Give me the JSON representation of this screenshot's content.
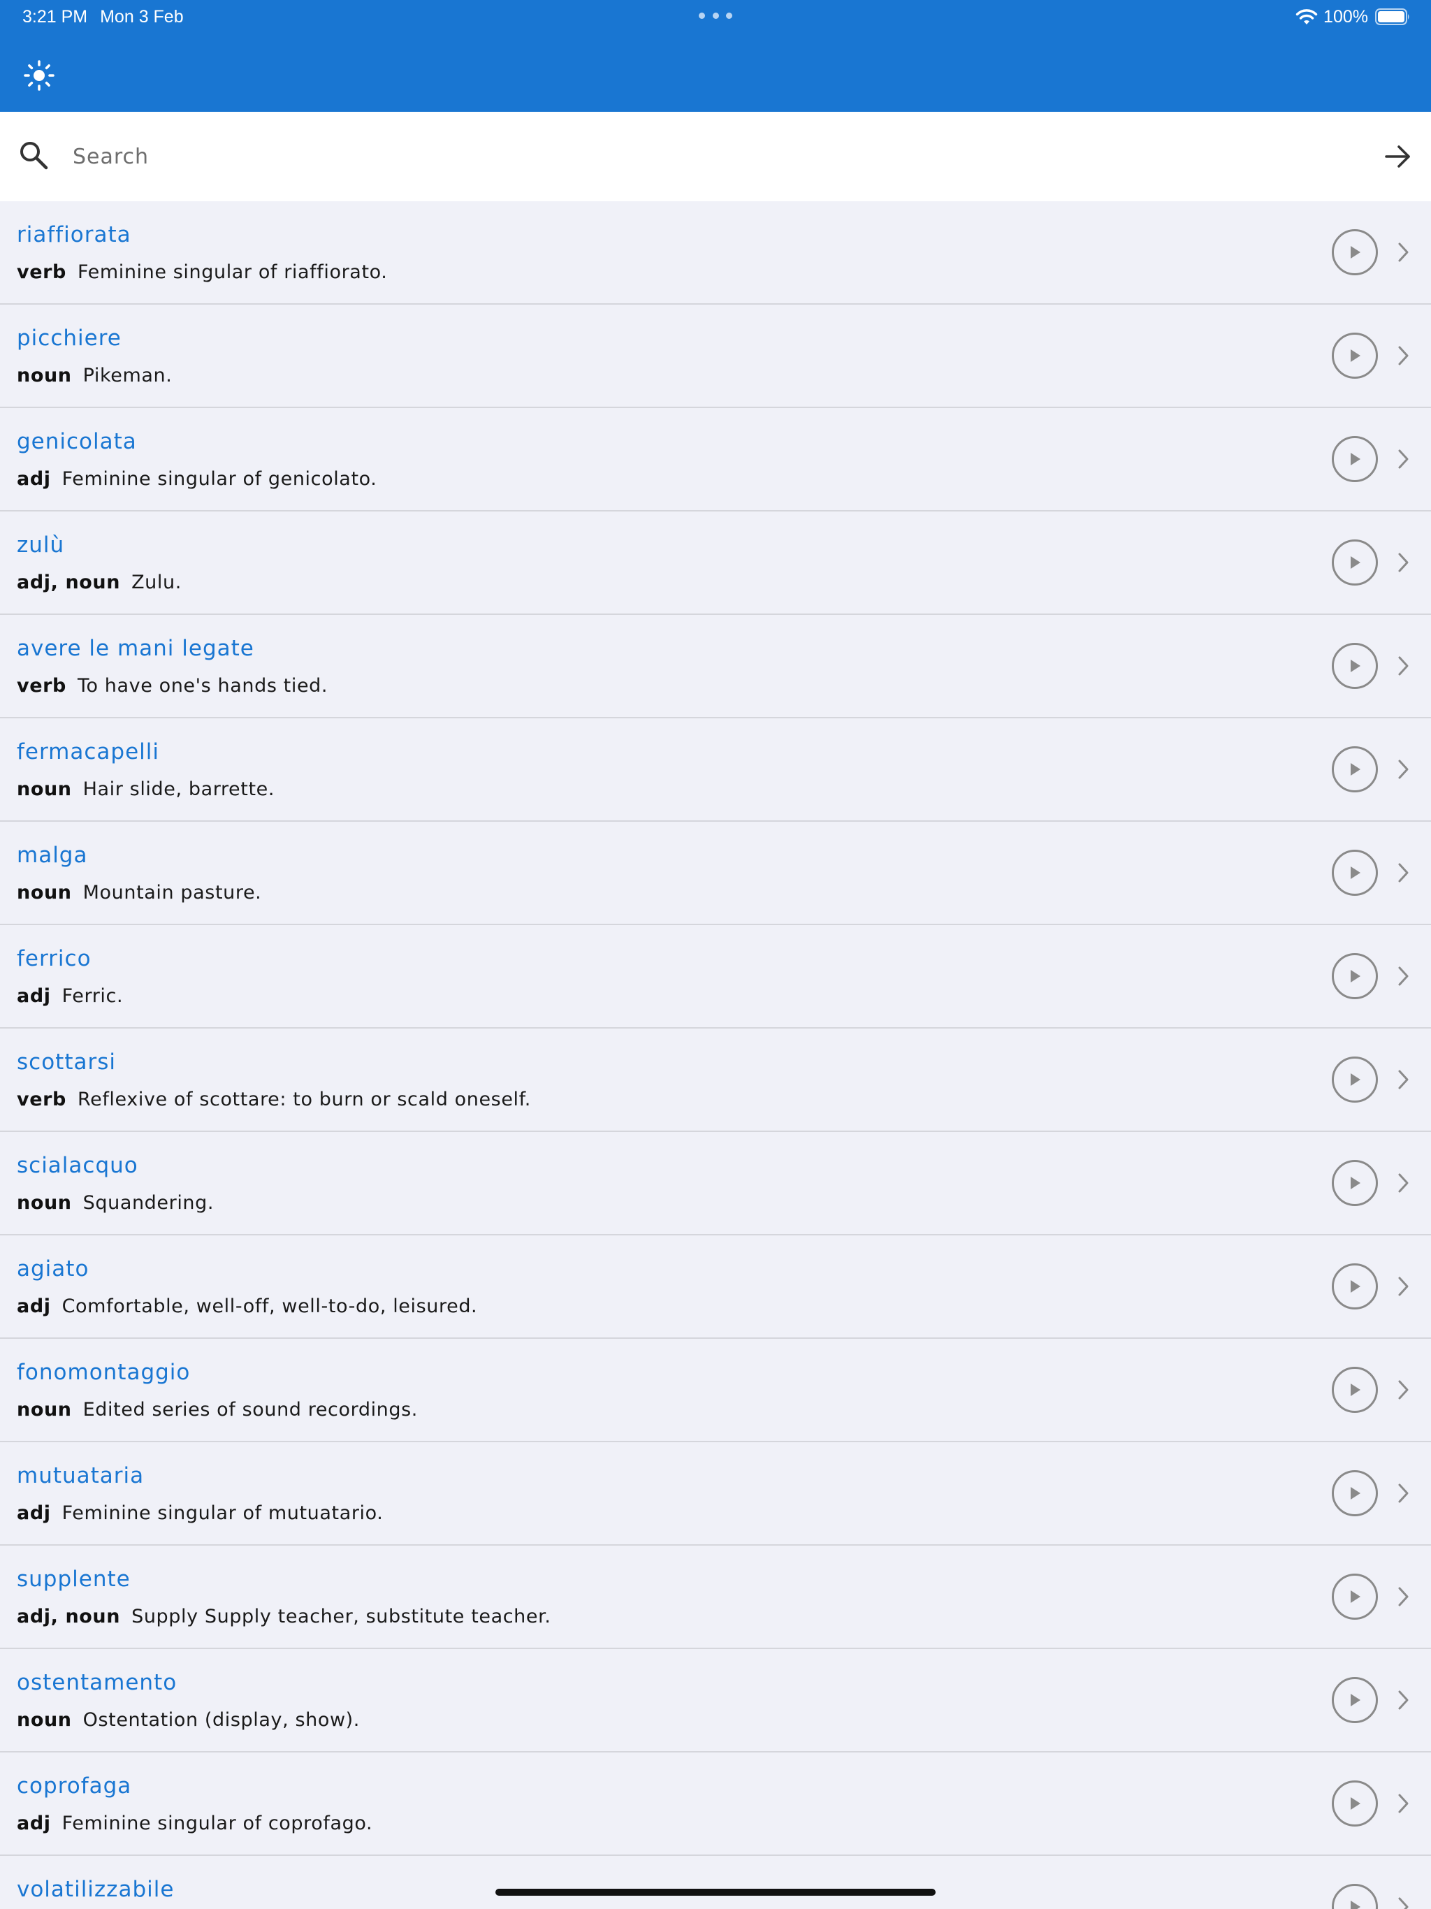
{
  "status_bar": {
    "time": "3:21 PM",
    "date": "Mon 3 Feb",
    "battery": "100%"
  },
  "toolbar": {
    "theme_icon": "sun-icon"
  },
  "search": {
    "placeholder": "Search",
    "value": ""
  },
  "words": [
    {
      "term": "riaffiorata",
      "pos": "verb",
      "definition": "Feminine singular of riaffiorato."
    },
    {
      "term": "picchiere",
      "pos": "noun",
      "definition": "Pikeman."
    },
    {
      "term": "genicolata",
      "pos": "adj",
      "definition": "Feminine singular of genicolato."
    },
    {
      "term": "zulù",
      "pos": "adj, noun",
      "definition": "Zulu."
    },
    {
      "term": "avere le mani legate",
      "pos": "verb",
      "definition": "To have one's hands tied."
    },
    {
      "term": "fermacapelli",
      "pos": "noun",
      "definition": "Hair slide, barrette."
    },
    {
      "term": "malga",
      "pos": "noun",
      "definition": "Mountain pasture."
    },
    {
      "term": "ferrico",
      "pos": "adj",
      "definition": "Ferric."
    },
    {
      "term": "scottarsi",
      "pos": "verb",
      "definition": "Reflexive of scottare: to burn or scald oneself."
    },
    {
      "term": "scialacquo",
      "pos": "noun",
      "definition": "Squandering."
    },
    {
      "term": "agiato",
      "pos": "adj",
      "definition": "Comfortable, well-off, well-to-do, leisured."
    },
    {
      "term": "fonomontaggio",
      "pos": "noun",
      "definition": "Edited series of sound recordings."
    },
    {
      "term": "mutuataria",
      "pos": "adj",
      "definition": "Feminine singular of mutuatario."
    },
    {
      "term": "supplente",
      "pos": "adj, noun",
      "definition": "Supply Supply teacher, substitute teacher."
    },
    {
      "term": "ostentamento",
      "pos": "noun",
      "definition": "Ostentation (display, show)."
    },
    {
      "term": "coprofaga",
      "pos": "adj",
      "definition": "Feminine singular of coprofago."
    },
    {
      "term": "volatilizzabile",
      "pos": "",
      "definition": ""
    }
  ],
  "colors": {
    "accent": "#1976d2",
    "list_background": "#f0f1f8",
    "divider": "#d5d6dc"
  }
}
